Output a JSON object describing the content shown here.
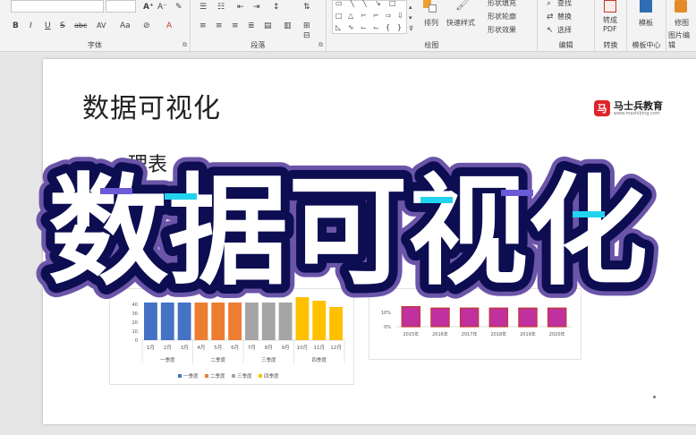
{
  "ribbon": {
    "font_group_label": "字体",
    "paragraph_group_label": "段落",
    "drawing_group_label": "绘图",
    "edit_group_label": "编辑",
    "convert_group_label": "转换",
    "template_center_label": "模板中心",
    "image_edit_label": "图片编辑",
    "arrange_label": "排列",
    "quick_styles_label": "快速样式",
    "shape_fill_label": "形状填充",
    "shape_outline_label": "形状轮廓",
    "shape_effect_label": "形状效果",
    "find_label": "查找",
    "replace_label": "替换",
    "select_label": "选择",
    "convert_pdf_label": "转成\nPDF",
    "template_label": "模板",
    "retouch_label": "修图",
    "font_format_buttons": [
      "B",
      "I",
      "U",
      "S",
      "abc",
      "AV",
      "Aa",
      "A"
    ]
  },
  "slide": {
    "title": "数据可视化",
    "partial_text": "理表",
    "brand_name": "马士兵教育",
    "brand_url": "www.mashibing.com"
  },
  "overlay": {
    "text": "数据可视化",
    "text_color": "#ffffff",
    "outline_color": "#0d0d52"
  },
  "chart_data": [
    {
      "type": "bar",
      "categories": [
        "1月",
        "2月",
        "3月",
        "4月",
        "5月",
        "6月",
        "7月",
        "8月",
        "9月",
        "10月",
        "11月",
        "12月"
      ],
      "groups": [
        "一季度",
        "二季度",
        "三季度",
        "四季度"
      ],
      "y_ticks": [
        "0",
        "10",
        "20",
        "30",
        "40"
      ],
      "ylim": [
        0,
        55
      ],
      "series": [
        {
          "name": "一季度",
          "color": "#4472c4",
          "values": [
            42,
            42,
            42,
            null,
            null,
            null,
            null,
            null,
            null,
            null,
            null,
            null
          ]
        },
        {
          "name": "二季度",
          "color": "#ed7d31",
          "values": [
            null,
            null,
            null,
            42,
            42,
            42,
            null,
            null,
            null,
            null,
            null,
            null
          ]
        },
        {
          "name": "三季度",
          "color": "#a5a5a5",
          "values": [
            null,
            null,
            null,
            null,
            null,
            null,
            42,
            42,
            42,
            null,
            null,
            null
          ]
        },
        {
          "name": "四季度",
          "color": "#ffc000",
          "values": [
            null,
            null,
            null,
            null,
            null,
            null,
            null,
            null,
            null,
            48,
            44,
            37
          ]
        }
      ],
      "legend": "bottom"
    },
    {
      "type": "bar",
      "categories": [
        "2015年",
        "2016年",
        "2017年",
        "2018年",
        "2019年",
        "2020年"
      ],
      "y_ticks": [
        "0%",
        "10%"
      ],
      "ylim": [
        0,
        25
      ],
      "series": [
        {
          "color": "#c0309e",
          "outline": "#c0392b",
          "values": [
            14,
            13,
            13,
            13,
            13,
            13
          ]
        }
      ],
      "legend": "none"
    }
  ]
}
